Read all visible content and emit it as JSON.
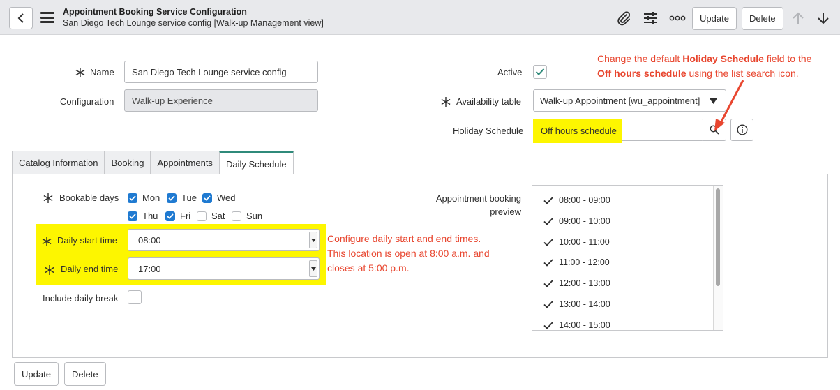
{
  "header": {
    "title": "Appointment Booking Service Configuration",
    "subtitle": "San Diego Tech Lounge service config [Walk-up Management view]",
    "update_label": "Update",
    "delete_label": "Delete"
  },
  "form": {
    "name_label": "Name",
    "name_value": "San Diego Tech Lounge service config",
    "configuration_label": "Configuration",
    "configuration_value": "Walk-up Experience",
    "active_label": "Active",
    "active_checked": true,
    "availability_label": "Availability table",
    "availability_value": "Walk-up Appointment [wu_appointment]",
    "holiday_label": "Holiday Schedule",
    "holiday_value": "Off hours schedule"
  },
  "annotations": {
    "holiday_note_line1_a": "Change the default ",
    "holiday_note_line1_b": "Holiday Schedule",
    "holiday_note_line1_c": " field to the",
    "holiday_note_line2_a": "Off hours schedule",
    "holiday_note_line2_b": " using the list search icon.",
    "times_note_line1": "Configure daily start and end times.",
    "times_note_line2": "This location is open at 8:00 a.m. and",
    "times_note_line3": "closes at 5:00 p.m."
  },
  "tabs": [
    {
      "label": "Catalog Information",
      "active": false
    },
    {
      "label": "Booking",
      "active": false
    },
    {
      "label": "Appointments",
      "active": false
    },
    {
      "label": "Daily Schedule",
      "active": true
    }
  ],
  "schedule": {
    "bookable_label": "Bookable days",
    "days": [
      {
        "label": "Mon",
        "checked": true
      },
      {
        "label": "Tue",
        "checked": true
      },
      {
        "label": "Wed",
        "checked": true
      },
      {
        "label": "Thu",
        "checked": true
      },
      {
        "label": "Fri",
        "checked": true
      },
      {
        "label": "Sat",
        "checked": false
      },
      {
        "label": "Sun",
        "checked": false
      }
    ],
    "start_label": "Daily start time",
    "start_value": "08:00",
    "end_label": "Daily end time",
    "end_value": "17:00",
    "break_label": "Include daily break",
    "break_checked": false,
    "preview_label_line1": "Appointment booking",
    "preview_label_line2": "preview",
    "slots": [
      "08:00 - 09:00",
      "09:00 - 10:00",
      "10:00 - 11:00",
      "11:00 - 12:00",
      "12:00 - 13:00",
      "13:00 - 14:00",
      "14:00 - 15:00"
    ]
  },
  "footer": {
    "update_label": "Update",
    "delete_label": "Delete"
  },
  "colors": {
    "highlight": "#fdf600",
    "annotation_text": "#e8462f",
    "checkbox_blue": "#1f7ad1",
    "active_check": "#2f8a7a",
    "tab_accent": "#2f8a7a"
  }
}
